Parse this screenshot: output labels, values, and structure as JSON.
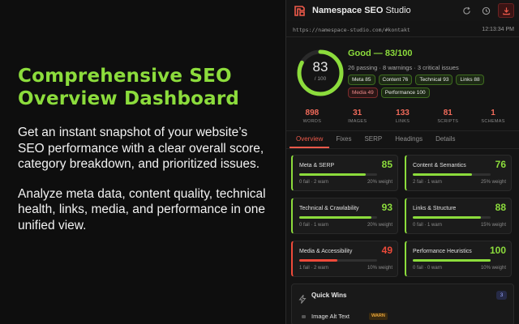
{
  "promo": {
    "title_line1": "Comprehensive SEO",
    "title_line2": "Overview Dashboard",
    "para1": "Get an instant snapshot of your website’s SEO performance with a clear overall score, category breakdown, and prioritized issues.",
    "para2": "Analyze meta data, content quality, technical health, links, media, and performance in one unified view."
  },
  "app": {
    "brand_bold": "Namespace SEO",
    "brand_light": "Studio",
    "url": "https://namespace-studio.com/#kontakt",
    "time": "12:13:34 PM",
    "icons": [
      "refresh-icon",
      "history-icon",
      "download-icon"
    ]
  },
  "score": {
    "value": 83,
    "max_label": "/ 100",
    "fraction": 0.83,
    "grade": "Good — 83/100",
    "summary": "26 passing · 8 warnings · 3 critical issues",
    "chips": [
      {
        "label": "Meta 85",
        "status": "good"
      },
      {
        "label": "Content 76",
        "status": "good"
      },
      {
        "label": "Technical 93",
        "status": "good"
      },
      {
        "label": "Links 88",
        "status": "good"
      },
      {
        "label": "Media 49",
        "status": "bad"
      },
      {
        "label": "Performance 100",
        "status": "good"
      }
    ],
    "colors": {
      "good": "#8cdc3c",
      "bad": "#ee4a3a",
      "accent": "#ef5a4a"
    }
  },
  "stats": [
    {
      "value": "898",
      "label": "WORDS"
    },
    {
      "value": "31",
      "label": "IMAGES"
    },
    {
      "value": "133",
      "label": "LINKS"
    },
    {
      "value": "81",
      "label": "SCRIPTS"
    },
    {
      "value": "1",
      "label": "SCHEMAS"
    }
  ],
  "tabs": [
    "Overview",
    "Fixes",
    "SERP",
    "Headings",
    "Details"
  ],
  "cards": [
    {
      "name": "Meta & SERP",
      "score": "85",
      "fraction": 0.85,
      "meta": "0 fail · 2 warn",
      "weight": "20% weight",
      "status": "good"
    },
    {
      "name": "Content & Semantics",
      "score": "76",
      "fraction": 0.76,
      "meta": "2 fail · 1 warn",
      "weight": "25% weight",
      "status": "good"
    },
    {
      "name": "Technical & Crawlability",
      "score": "93",
      "fraction": 0.93,
      "meta": "0 fail · 1 warn",
      "weight": "20% weight",
      "status": "good"
    },
    {
      "name": "Links & Structure",
      "score": "88",
      "fraction": 0.88,
      "meta": "0 fail · 1 warn",
      "weight": "15% weight",
      "status": "good"
    },
    {
      "name": "Media & Accessibility",
      "score": "49",
      "fraction": 0.49,
      "meta": "1 fail · 2 warn",
      "weight": "10% weight",
      "status": "bad"
    },
    {
      "name": "Performance Heuristics",
      "score": "100",
      "fraction": 1.0,
      "meta": "0 fail · 0 warn",
      "weight": "10% weight",
      "status": "good"
    }
  ],
  "quick_wins": {
    "title": "Quick Wins",
    "count": "3",
    "item": "Image Alt Text",
    "badge": "WARN"
  }
}
